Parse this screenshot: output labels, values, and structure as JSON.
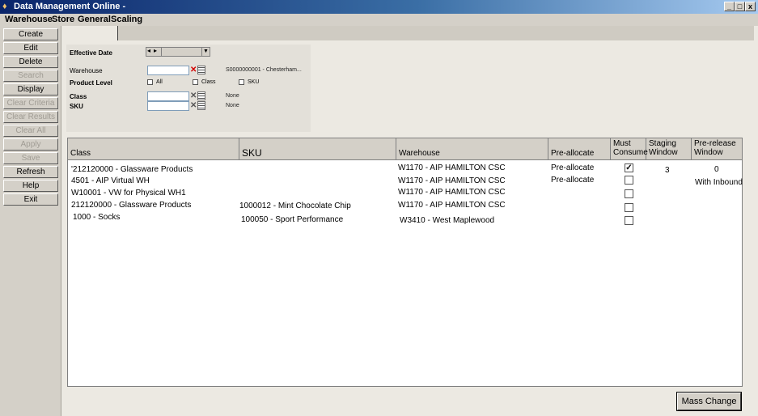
{
  "window": {
    "title": "Data Management Online -",
    "min_glyph": "_",
    "max_glyph": "□",
    "close_glyph": "x"
  },
  "menu": [
    "Warehouse",
    "Store",
    "General",
    "Scaling"
  ],
  "sidebar": {
    "buttons": [
      {
        "label": "Create",
        "enabled": true
      },
      {
        "label": "Edit",
        "enabled": true
      },
      {
        "label": "Delete",
        "enabled": true
      },
      {
        "label": "Search",
        "enabled": false
      },
      {
        "label": "Display",
        "enabled": true
      },
      {
        "label": "Clear Criteria",
        "enabled": false
      },
      {
        "label": "Clear Results",
        "enabled": false
      },
      {
        "label": "Clear All",
        "enabled": false
      },
      {
        "label": "Apply",
        "enabled": false
      },
      {
        "label": "Save",
        "enabled": false
      },
      {
        "label": "Refresh",
        "enabled": true
      },
      {
        "label": "Help",
        "enabled": true
      },
      {
        "label": "Exit",
        "enabled": true
      }
    ]
  },
  "filters": {
    "effective_date_label": "Effective Date",
    "warehouse_label": "Warehouse",
    "warehouse_value": "",
    "warehouse_desc": "S0000000001 - Chesterham...",
    "product_level_label": "Product Level",
    "options": {
      "all": "All",
      "class": "Class",
      "sku": "SKU"
    },
    "class_label": "Class",
    "class_value": "",
    "class_desc": "None",
    "sku_label": "SKU",
    "sku_value": "",
    "sku_desc": "None"
  },
  "grid": {
    "columns": {
      "class": "Class",
      "sku": "SKU",
      "warehouse": "Warehouse",
      "preallocate": "Pre-allocate",
      "must_consume": "Must Consume",
      "staging_window": "Staging Window",
      "prerelease_window": "Pre-release Window"
    },
    "rows": [
      {
        "class": "'212120000 - Glassware Products",
        "sku": "",
        "warehouse": "W1170 - AIP HAMILTON CSC",
        "preallocate": "Pre-allocate",
        "must_consume": true,
        "staging": "3",
        "prerelease": "0"
      },
      {
        "class": "4501 - AIP Virtual WH",
        "sku": "",
        "warehouse": "W1170 - AIP HAMILTON CSC",
        "preallocate": "Pre-allocate",
        "must_consume": false,
        "staging": "",
        "prerelease": "With Inbound"
      },
      {
        "class": "W10001 - VW for Physical WH1",
        "sku": "",
        "warehouse": "W1170 - AIP HAMILTON CSC",
        "preallocate": "",
        "must_consume": false,
        "staging": "",
        "prerelease": ""
      },
      {
        "class": "212120000 - Glassware Products",
        "sku": "1000012 - Mint Chocolate Chip",
        "warehouse": "W1170 - AIP HAMILTON CSC",
        "preallocate": "",
        "must_consume": false,
        "staging": "",
        "prerelease": ""
      },
      {
        "class": "1000 - Socks",
        "sku": "100050 - Sport Performance",
        "warehouse": "W3410 - West Maplewood",
        "preallocate": "",
        "must_consume": false,
        "staging": "",
        "prerelease": ""
      }
    ]
  },
  "mass_change_label": "Mass Change",
  "colors": {
    "title_start": "#0a246a",
    "title_end": "#a6caf0",
    "clear_x": "#d40000"
  }
}
